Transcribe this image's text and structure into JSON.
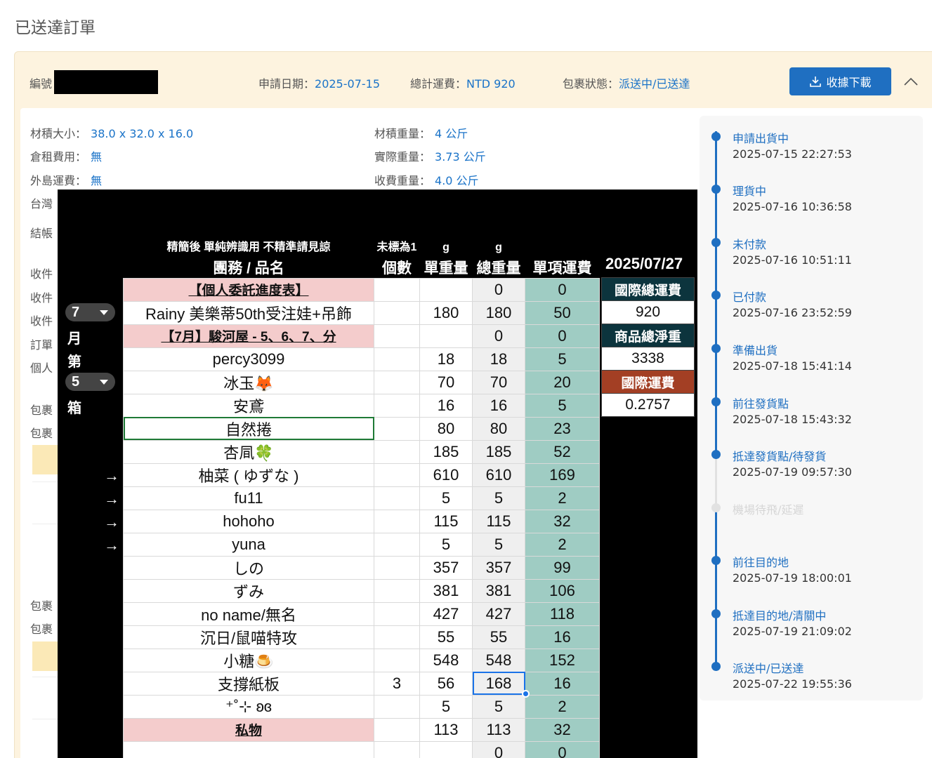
{
  "page": {
    "title": "已送達訂單"
  },
  "header": {
    "id_label": "編號",
    "apply_date_label": "申請日期：",
    "apply_date": "2025-07-15",
    "shipping_total_label": "總計運費：",
    "shipping_total": "NTD 920",
    "status_label": "包裹狀態：",
    "status": "派送中/已送達",
    "receipt_button": "收據下載"
  },
  "details": {
    "size_label": "材積大小：",
    "size": "38.0 x 32.0 x 16.0",
    "vol_weight_label": "材積重量：",
    "vol_weight": "4 公斤",
    "storage_label": "倉租費用：",
    "storage": "無",
    "actual_weight_label": "實際重量：",
    "actual_weight": "3.73 公斤",
    "island_label": "外島運費：",
    "island": "無",
    "billing_weight_label": "收費重量：",
    "billing_weight": "4.0 公斤",
    "clipped": [
      "台灣",
      "結帳",
      "收件",
      "收件",
      "收件",
      "訂單",
      "個人",
      "包裹",
      "包裹",
      "包裹",
      "包裹"
    ]
  },
  "timeline": [
    {
      "label": "申請出貨中",
      "time": "2025-07-15 22:27:53",
      "done": true
    },
    {
      "label": "理貨中",
      "time": "2025-07-16 10:36:58",
      "done": true
    },
    {
      "label": "未付款",
      "time": "2025-07-16 10:51:11",
      "done": true
    },
    {
      "label": "已付款",
      "time": "2025-07-16 23:52:59",
      "done": true
    },
    {
      "label": "準備出貨",
      "time": "2025-07-18 15:41:14",
      "done": true
    },
    {
      "label": "前往發貨點",
      "time": "2025-07-18 15:43:32",
      "done": true
    },
    {
      "label": "抵達發貨點/待發貨",
      "time": "2025-07-19 09:57:30",
      "done": true
    },
    {
      "label": "機場待飛/延遲",
      "time": "",
      "done": false
    },
    {
      "label": "前往目的地",
      "time": "2025-07-19 18:00:01",
      "done": true
    },
    {
      "label": "抵達目的地/清關中",
      "time": "2025-07-19 21:09:02",
      "done": true
    },
    {
      "label": "派送中/已送達",
      "time": "2025-07-22 19:55:36",
      "done": true
    }
  ],
  "sheet": {
    "header1": {
      "note": "精簡後 單純辨識用 不精準請見諒",
      "count_note": "未標為1",
      "unit1": "g",
      "unit2": "g"
    },
    "header2": {
      "name": "團務 / 品名",
      "count": "個數",
      "unit_weight": "單重量",
      "total_weight": "總重量",
      "fee": "單項運費",
      "date": "2025/07/27"
    },
    "rows": [
      {
        "name": "【個人委託進度表】",
        "count": "",
        "unit": "",
        "total": "0",
        "fee": "0",
        "pink": true
      },
      {
        "name": "Rainy 美樂蒂50th受注娃+吊飾",
        "count": "",
        "unit": "180",
        "total": "180",
        "fee": "50"
      },
      {
        "name": "【7月】駿河屋 - 5、6、7、分",
        "count": "",
        "unit": "",
        "total": "0",
        "fee": "0",
        "pink": true
      },
      {
        "name": "percy3099",
        "count": "",
        "unit": "18",
        "total": "18",
        "fee": "5"
      },
      {
        "name": "冰玉🦊",
        "count": "",
        "unit": "70",
        "total": "70",
        "fee": "20"
      },
      {
        "name": "安鳶",
        "count": "",
        "unit": "16",
        "total": "16",
        "fee": "5"
      },
      {
        "name": "自然捲",
        "count": "",
        "unit": "80",
        "total": "80",
        "fee": "23",
        "selected": true
      },
      {
        "name": "杏凬🍀",
        "count": "",
        "unit": "185",
        "total": "185",
        "fee": "52"
      },
      {
        "name": "柚菜 ( ゆずな )",
        "count": "",
        "unit": "610",
        "total": "610",
        "fee": "169",
        "arrow": true
      },
      {
        "name": "fu11",
        "count": "",
        "unit": "5",
        "total": "5",
        "fee": "2",
        "arrow": true
      },
      {
        "name": "hohoho",
        "count": "",
        "unit": "115",
        "total": "115",
        "fee": "32",
        "arrow": true
      },
      {
        "name": "yuna",
        "count": "",
        "unit": "5",
        "total": "5",
        "fee": "2",
        "arrow": true
      },
      {
        "name": "しの",
        "count": "",
        "unit": "357",
        "total": "357",
        "fee": "99"
      },
      {
        "name": "ずみ",
        "count": "",
        "unit": "381",
        "total": "381",
        "fee": "106"
      },
      {
        "name": "no name/無名",
        "count": "",
        "unit": "427",
        "total": "427",
        "fee": "118"
      },
      {
        "name": "沉日/鼠喵特攻",
        "count": "",
        "unit": "55",
        "total": "55",
        "fee": "16"
      },
      {
        "name": "小糖🍮",
        "count": "",
        "unit": "548",
        "total": "548",
        "fee": "152"
      },
      {
        "name": "支撐紙板",
        "count": "3",
        "unit": "56",
        "total": "168",
        "fee": "16",
        "active": true
      },
      {
        "name": "⁺˚⊹ ʚɞ",
        "count": "",
        "unit": "5",
        "total": "5",
        "fee": "2"
      },
      {
        "name": "私物",
        "count": "",
        "unit": "113",
        "total": "113",
        "fee": "32",
        "pink": true
      },
      {
        "name": "",
        "count": "",
        "unit": "",
        "total": "0",
        "fee": "0"
      }
    ],
    "summary": [
      {
        "label": "國際總運費",
        "value": "920",
        "style": "dark"
      },
      {
        "label": "商品總淨重",
        "value": "3338",
        "style": "dark"
      },
      {
        "label": "國際運費",
        "value": "0.2757",
        "style": "red"
      }
    ],
    "side_select": {
      "month_value": "7",
      "month_char": "月",
      "di_char": "第",
      "box_value": "5",
      "box_char": "箱"
    },
    "arrow_glyph": "→"
  }
}
